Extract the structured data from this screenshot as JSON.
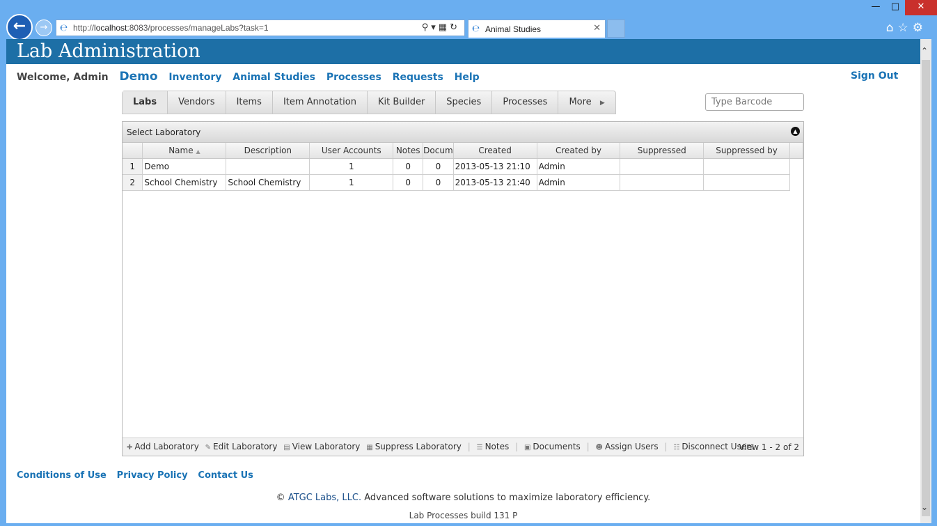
{
  "browser": {
    "url_prefix": "http://",
    "url_host": "localhost",
    "url_rest": ":8083/processes/manageLabs?task=1",
    "tab_title": "Animal Studies"
  },
  "header": {
    "app_title": "Lab Administration",
    "welcome": "Welcome, Admin",
    "lab_name": "Demo",
    "nav": [
      "Inventory",
      "Animal Studies",
      "Processes",
      "Requests",
      "Help"
    ],
    "sign_out": "Sign Out"
  },
  "subtabs": [
    "Labs",
    "Vendors",
    "Items",
    "Item Annotation",
    "Kit Builder",
    "Species",
    "Processes",
    "More"
  ],
  "barcode_placeholder": "Type Barcode",
  "grid": {
    "caption": "Select Laboratory",
    "columns": [
      "Name",
      "Description",
      "User Accounts",
      "Notes",
      "Docum",
      "Created",
      "Created by",
      "Suppressed",
      "Suppressed by"
    ],
    "rows": [
      {
        "n": "1",
        "name": "Demo",
        "description": "",
        "users": "1",
        "notes": "0",
        "docs": "0",
        "created": "2013-05-13 21:10",
        "created_by": "Admin",
        "suppressed": "",
        "suppressed_by": ""
      },
      {
        "n": "2",
        "name": "School Chemistry",
        "description": "School Chemistry",
        "users": "1",
        "notes": "0",
        "docs": "0",
        "created": "2013-05-13 21:40",
        "created_by": "Admin",
        "suppressed": "",
        "suppressed_by": ""
      }
    ],
    "actions": [
      "Add Laboratory",
      "Edit Laboratory",
      "View Laboratory",
      "Suppress Laboratory",
      "Notes",
      "Documents",
      "Assign Users",
      "Disconnect Users"
    ],
    "view_count": "View 1 - 2 of 2"
  },
  "footer": {
    "links": [
      "Conditions of Use",
      "Privacy Policy",
      "Contact Us"
    ],
    "copyright_symbol": "©",
    "company": "ATGC Labs, LLC.",
    "tagline": "Advanced software solutions to maximize laboratory efficiency.",
    "build": "Lab Processes build 131 P"
  }
}
